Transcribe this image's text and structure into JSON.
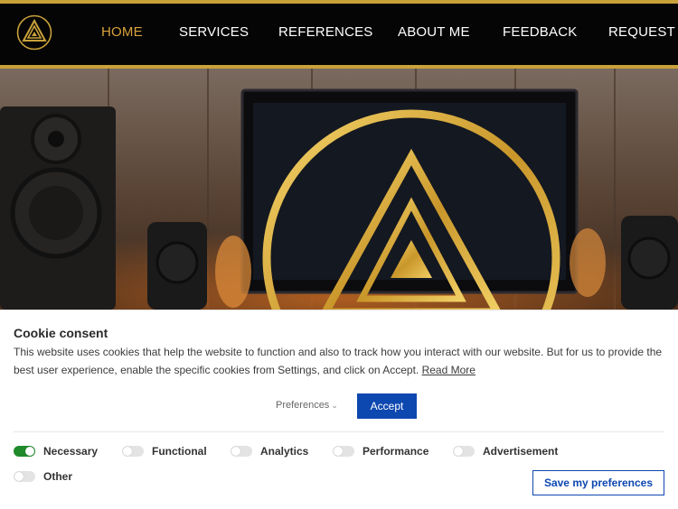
{
  "nav": {
    "items": [
      {
        "label": "HOME",
        "active": true
      },
      {
        "label": "SERVICES",
        "active": false
      },
      {
        "label": "REFERENCES",
        "active": false
      },
      {
        "label": "ABOUT ME",
        "active": false
      },
      {
        "label": "FEEDBACK",
        "active": false
      },
      {
        "label": "REQUEST A",
        "active": false
      }
    ]
  },
  "colors": {
    "gold": "#c9a13a",
    "nav_active": "#d9a23a",
    "header_bg": "#050505",
    "accept_blue": "#0d47b0",
    "toggle_on": "#1f8a2a"
  },
  "cookie": {
    "title": "Cookie consent",
    "text": "This website uses cookies that help the website to function and also to track how you interact with our website. But for us to provide the best user experience, enable the specific cookies from Settings, and click on Accept.",
    "read_more": "Read More",
    "preferences_label": "Preferences",
    "accept_label": "Accept",
    "categories": [
      {
        "label": "Necessary",
        "enabled": true
      },
      {
        "label": "Functional",
        "enabled": false
      },
      {
        "label": "Analytics",
        "enabled": false
      },
      {
        "label": "Performance",
        "enabled": false
      },
      {
        "label": "Advertisement",
        "enabled": false
      },
      {
        "label": "Other",
        "enabled": false
      }
    ],
    "save_label": "Save my preferences"
  }
}
